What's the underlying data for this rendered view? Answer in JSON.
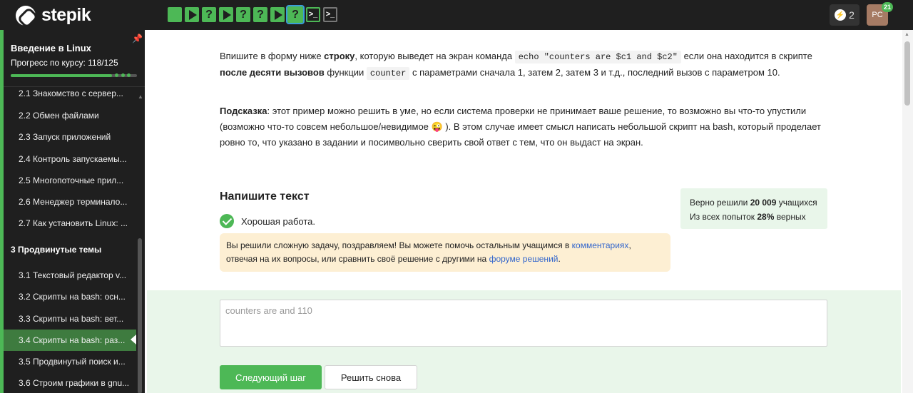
{
  "header": {
    "brand": "stepik",
    "steps": [
      {
        "kind": "done"
      },
      {
        "kind": "video"
      },
      {
        "kind": "quiz",
        "glyph": "?"
      },
      {
        "kind": "video"
      },
      {
        "kind": "quiz",
        "glyph": "?"
      },
      {
        "kind": "quiz",
        "glyph": "?"
      },
      {
        "kind": "video"
      },
      {
        "kind": "quiz-current",
        "glyph": "?"
      },
      {
        "kind": "terminal",
        "glyph": ">_"
      },
      {
        "kind": "terminal-grey",
        "glyph": ">_"
      }
    ],
    "energy_count": "2",
    "avatar_initials": "PC",
    "avatar_badge": "21"
  },
  "sidebar": {
    "course_title": "Введение в Linux",
    "progress_label": "Прогресс по курсу:  118/125",
    "progress_fraction": 0.944,
    "lessons": [
      {
        "label": "2.1  Знакомство с сервер..."
      },
      {
        "label": "2.2  Обмен файлами"
      },
      {
        "label": "2.3  Запуск приложений"
      },
      {
        "label": "2.4  Контроль запускаемы..."
      },
      {
        "label": "2.5  Многопоточные прил..."
      },
      {
        "label": "2.6  Менеджер терминало..."
      },
      {
        "label": "2.7  Как установить Linux: ..."
      }
    ],
    "module_label": "3  Продвинутые темы",
    "module_lessons": [
      {
        "label": "3.1  Текстовый редактор v..."
      },
      {
        "label": "3.2  Скрипты на bash: осн..."
      },
      {
        "label": "3.3  Скрипты на bash: вет..."
      },
      {
        "label": "3.4  Скрипты на bash: раз..."
      },
      {
        "label": "3.5  Продвинутый поиск и..."
      },
      {
        "label": "3.6  Строим графики в gnu..."
      }
    ]
  },
  "task": {
    "p1_a": "Впишите в форму ниже ",
    "p1_b": "строку",
    "p1_c": ", которую выведет на экран команда ",
    "p1_code1": "echo \"counters are $c1 and $c2\"",
    "p1_d": " если она находится в скрипте ",
    "p1_e": "после десяти вызовов",
    "p1_f": " функции ",
    "p1_code2": "counter",
    "p1_g": " с параметрами сначала 1, затем 2, затем 3 и т.д., последний вызов с параметром 10.",
    "hint_label": "Подсказка",
    "hint_text": ": этот пример можно решить в уме, но если система проверки не принимает ваше решение, то возможно вы что-то упустили (возможно что-то совсем небольшое/невидимое 😜 ). В этом случае имеет смысл написать небольшой скрипт на bash, который проделает ровно то, что указано в задании и посимвольно сверить свой ответ с тем, что он выдаст на экран."
  },
  "answer": {
    "section_title": "Напишите текст",
    "success_text": "Хорошая работа.",
    "stats_line1_a": "Верно решили ",
    "stats_line1_b": "20 009",
    "stats_line1_c": " учащихся",
    "stats_line2_a": "Из всех попыток ",
    "stats_line2_b": "28%",
    "stats_line2_c": " верных",
    "notice_a": "Вы решили сложную задачу, поздравляем! Вы можете помочь остальным учащимся в ",
    "notice_link1": "комментариях",
    "notice_b": ", отвечая на их вопросы, или сравнить своё решение с другими на ",
    "notice_link2": "форуме решений",
    "notice_c": ".",
    "input_value": "counters are  and 110",
    "next_button": "Следующий шаг",
    "retry_button": "Решить снова"
  },
  "colors": {
    "accent_green": "#4db856",
    "dark_bg": "#1f1f1f",
    "notice_bg": "#fdefd3",
    "link": "#3366cc"
  }
}
